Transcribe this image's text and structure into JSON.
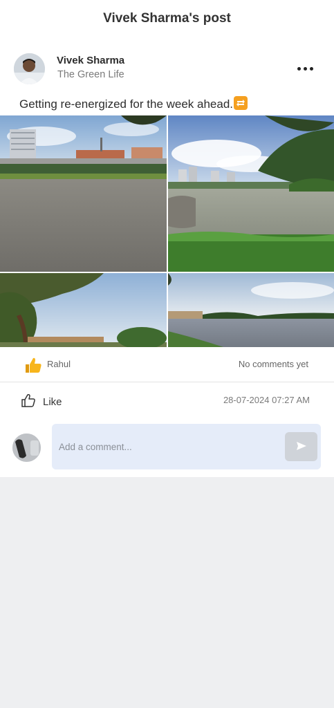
{
  "header": {
    "title": "Vivek Sharma's post"
  },
  "post": {
    "author": "Vivek Sharma",
    "group": "The Green Life",
    "text": "Getting re-energized for the week ahead.",
    "text_emoji": "repeat-emoji",
    "photos": [
      {
        "description_icon": "lake-with-city-skyline-photo"
      },
      {
        "description_icon": "lake-with-trees-and-towers-photo"
      },
      {
        "description_icon": "tree-and-lake-edge-photo"
      },
      {
        "description_icon": "calm-lake-reflection-photo"
      }
    ]
  },
  "reactions": {
    "emoji": "thumbs-up-emoji",
    "reactor": "Rahul",
    "comments_status": "No comments yet"
  },
  "actions": {
    "like_label": "Like",
    "timestamp": "28-07-2024 07:27 AM"
  },
  "comment": {
    "placeholder": "Add a comment..."
  },
  "colors": {
    "comment_box": "#e5ecf9",
    "send_button": "#cfd3d9",
    "background": "#eeeff1",
    "like_emoji": "#f7b51c"
  }
}
